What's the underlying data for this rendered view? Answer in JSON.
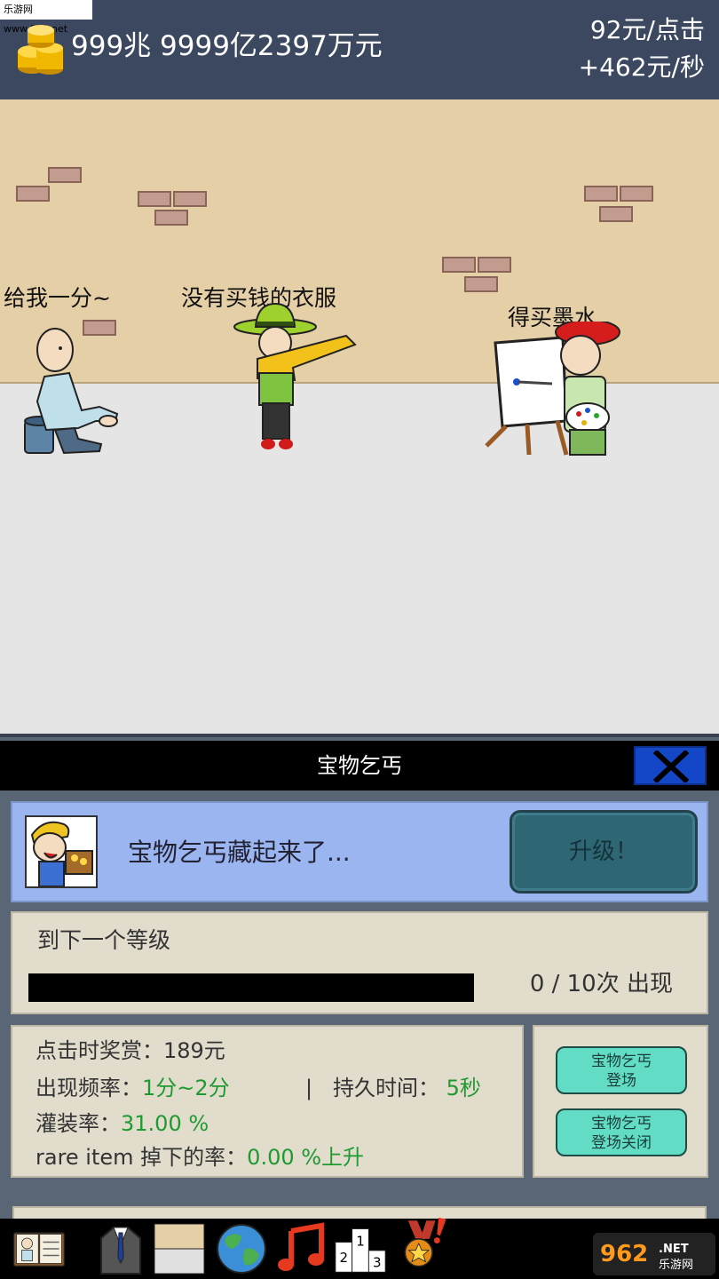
{
  "watermark": "乐游网 www.962.net",
  "hud": {
    "money_total": "999兆 9999亿2397万元",
    "per_click": "92元/点击",
    "per_second": "+462元/秒"
  },
  "scene": {
    "speech": [
      {
        "text": "给我一分~"
      },
      {
        "text": "没有买钱的衣服"
      },
      {
        "text": "得买墨水"
      }
    ]
  },
  "panel": {
    "title": "宝物乞丐",
    "status_text": "宝物乞丐藏起来了...",
    "upgrade_label": "升级！",
    "level": {
      "title": "到下一个等级",
      "current": 0,
      "target": 10,
      "progress_fraction": 0,
      "count_label": "0 / 10次 出现"
    },
    "stats": {
      "click_reward_label": "点击时奖赏：",
      "click_reward_value": "189元",
      "frequency_label": "出现频率：",
      "frequency_value": "1分~2分",
      "separator": "|",
      "duration_label": "持久时间：",
      "duration_value": "5秒",
      "fill_rate_label": "灌装率：",
      "fill_rate_value": "31.00 %",
      "rare_label": "rare item 掉下的率：",
      "rare_value": "0.00 %上升"
    },
    "buttons": {
      "appear_line1": "宝物乞丐",
      "appear_line2": "登场",
      "close_line1": "宝物乞丐",
      "close_line2": "登场关闭"
    }
  },
  "nav": {
    "icons": [
      "book-icon",
      "suit-icon",
      "wall-icon",
      "globe-icon",
      "music-note-icon",
      "ranking-podium-icon",
      "medal-alert-icon"
    ]
  },
  "logo": "962 乐游网",
  "colors": {
    "hud_bg": "#3b4860",
    "wall": "#e4cfa7",
    "floor": "#e5e5e5",
    "info_card": "#9ab5f0",
    "upgrade_button": "#2f6674",
    "action_button": "#62dcc5",
    "close_button": "#1447c8",
    "stat_green": "#1f9a31"
  }
}
